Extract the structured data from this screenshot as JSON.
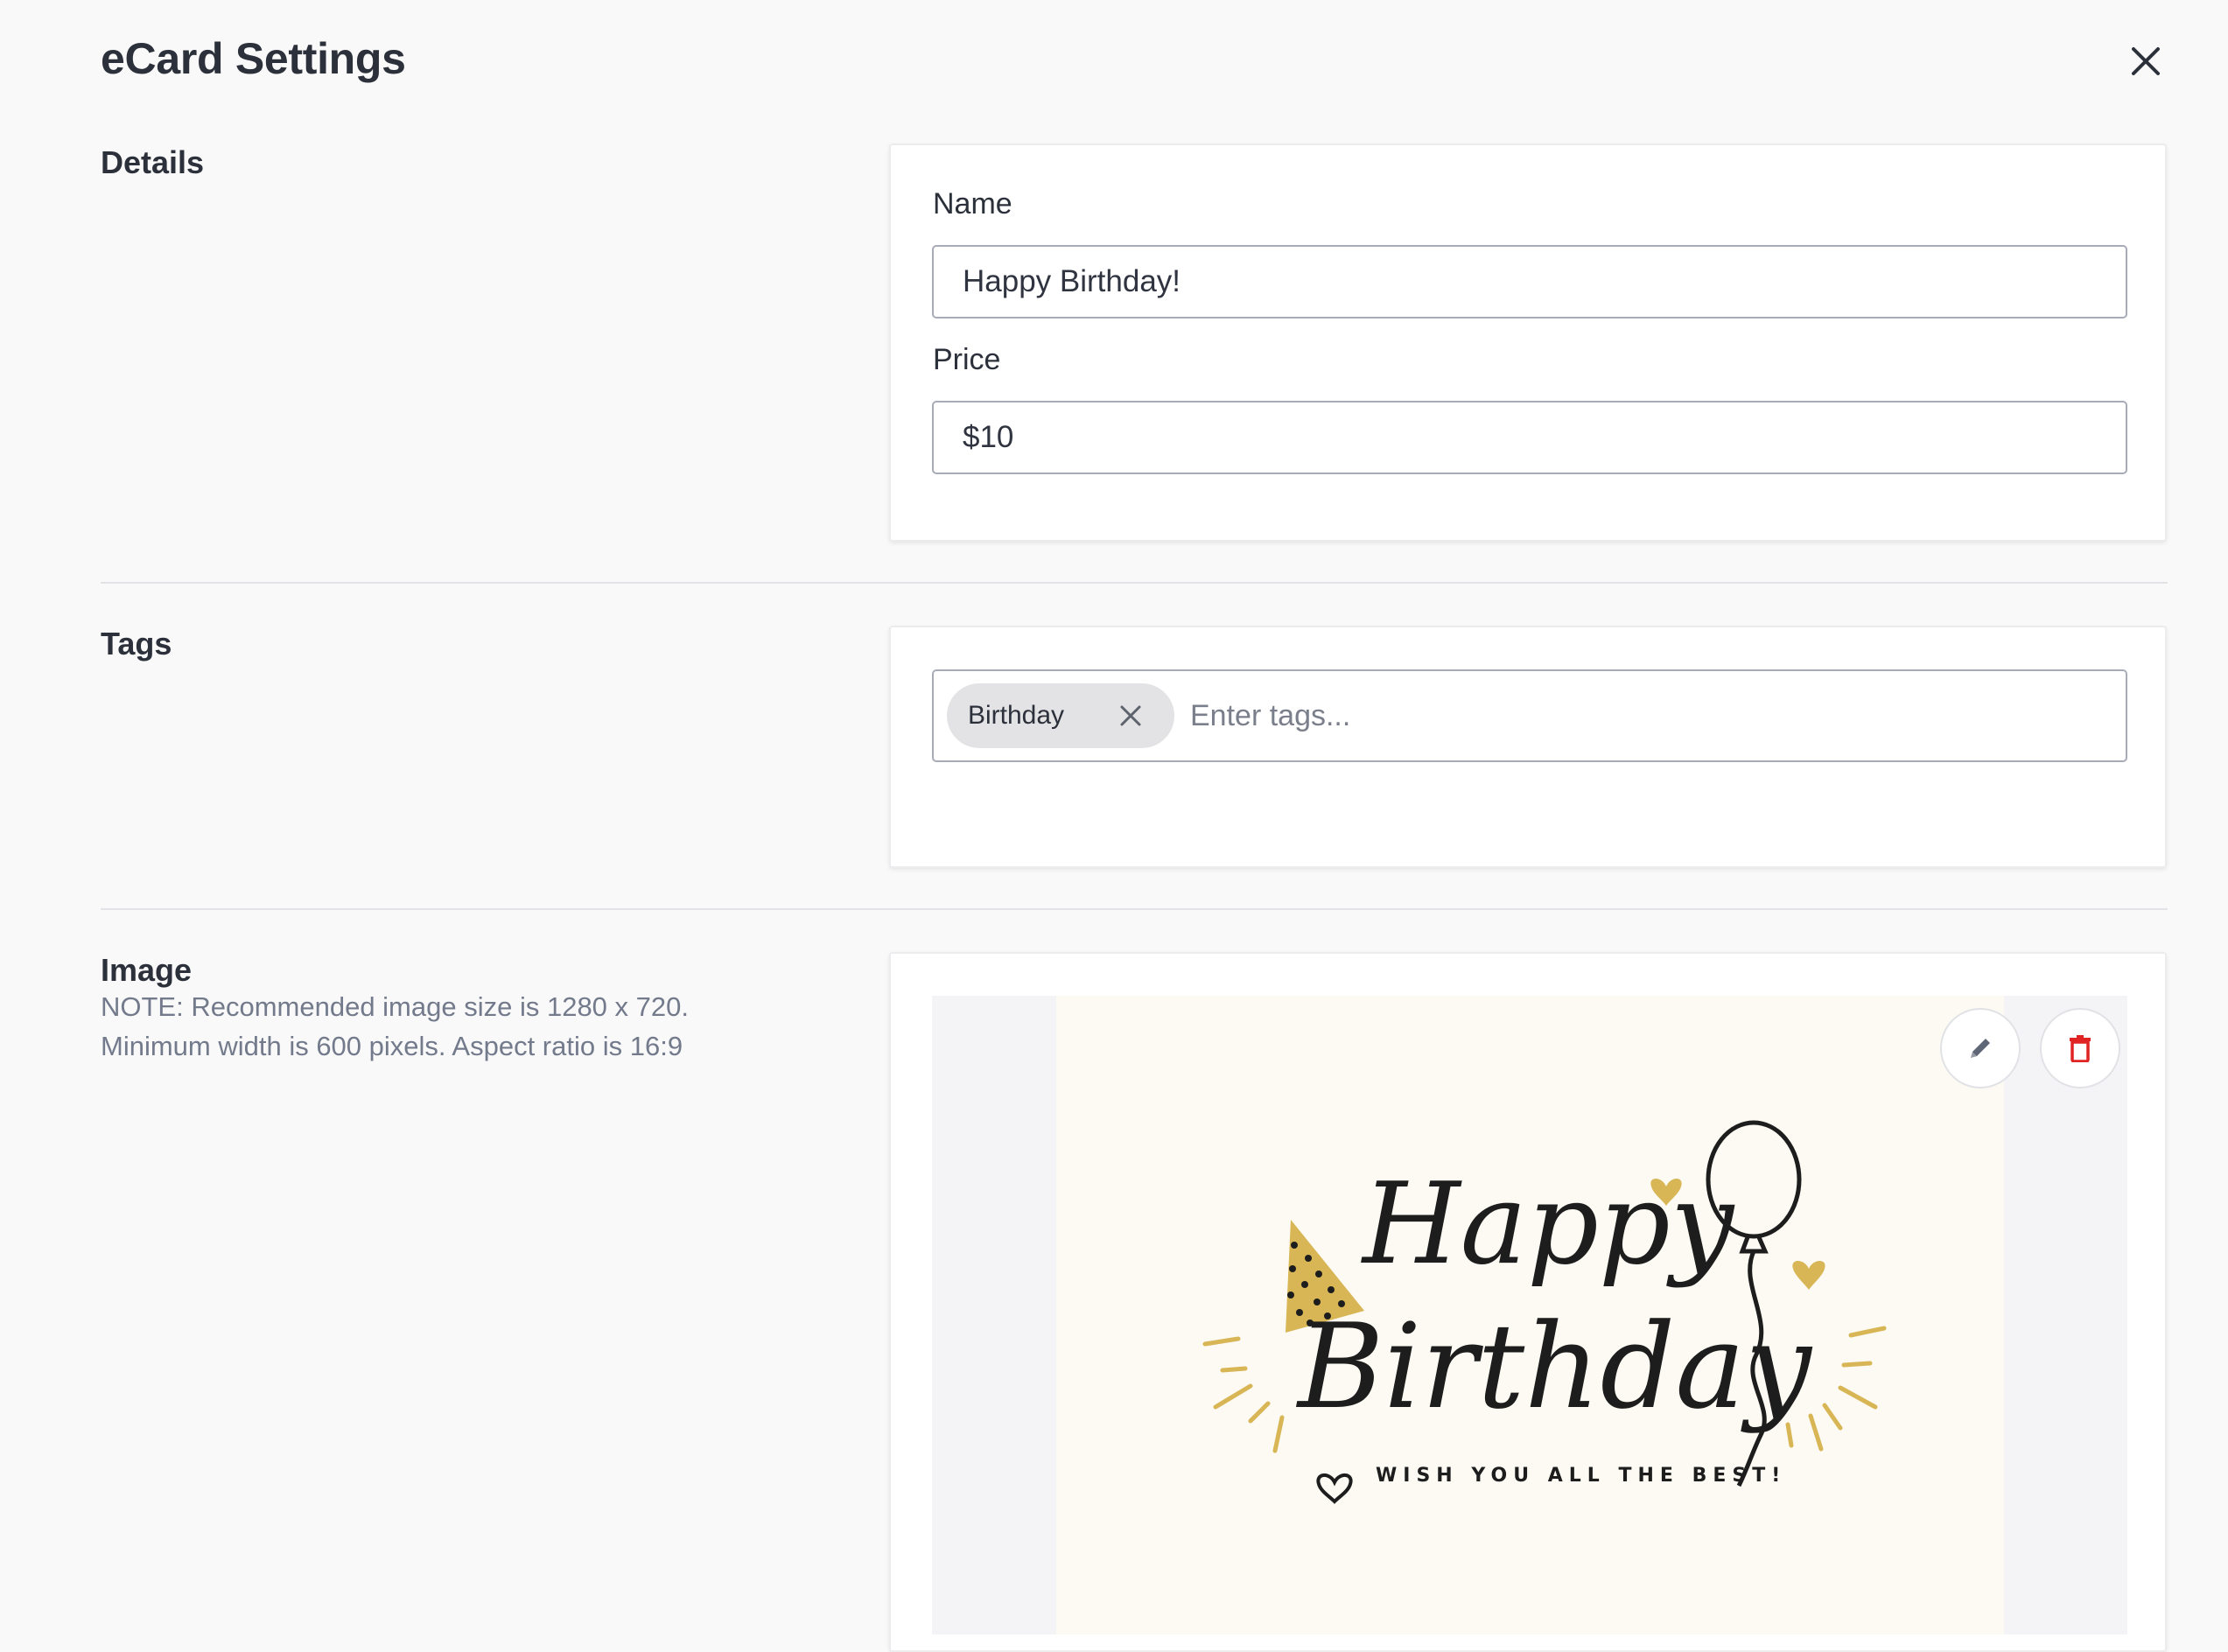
{
  "page": {
    "title": "eCard Settings"
  },
  "details": {
    "section_title": "Details",
    "name_label": "Name",
    "name_value": "Happy Birthday!",
    "price_label": "Price",
    "price_value": "$10"
  },
  "tags": {
    "section_title": "Tags",
    "items": [
      {
        "label": "Birthday"
      }
    ],
    "input_placeholder": "Enter tags..."
  },
  "image": {
    "section_title": "Image",
    "note": "NOTE: Recommended image size is 1280 x 720. Minimum width is 600 pixels. Aspect ratio is 16:9",
    "card": {
      "headline_line1": "Happy",
      "headline_line2": "Birthday",
      "subtitle": "WISH YOU ALL THE BEST!",
      "background_color": "#fcfaf2",
      "accent_color": "#d8b655"
    },
    "edit_icon": "pencil-icon",
    "delete_icon": "trash-icon",
    "delete_color": "#e02424"
  },
  "icons": {
    "close": "close-icon",
    "tag_remove": "close-icon"
  }
}
